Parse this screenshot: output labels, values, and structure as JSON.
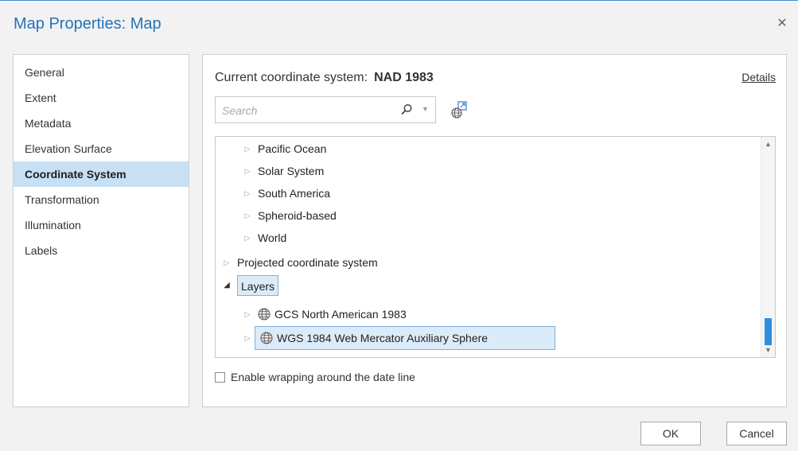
{
  "dialog": {
    "title": "Map Properties: Map",
    "close_glyph": "✕"
  },
  "sidebar": {
    "items": [
      {
        "label": "General"
      },
      {
        "label": "Extent"
      },
      {
        "label": "Metadata"
      },
      {
        "label": "Elevation Surface"
      },
      {
        "label": "Coordinate System",
        "active": true
      },
      {
        "label": "Transformation"
      },
      {
        "label": "Illumination"
      },
      {
        "label": "Labels"
      }
    ]
  },
  "coordinate": {
    "current_label": "Current coordinate system:",
    "current_value": "NAD 1983",
    "details_link": "Details",
    "search_placeholder": "Search",
    "search_icon": "search-icon",
    "globe_icon": "add-coordinate-system-icon"
  },
  "tree": {
    "items": [
      {
        "label": "Pacific Ocean",
        "level": 1,
        "state": "collapsed"
      },
      {
        "label": "Solar System",
        "level": 1,
        "state": "collapsed"
      },
      {
        "label": "South America",
        "level": 1,
        "state": "collapsed"
      },
      {
        "label": "Spheroid-based",
        "level": 1,
        "state": "collapsed"
      },
      {
        "label": "World",
        "level": 1,
        "state": "collapsed"
      },
      {
        "label": "Projected coordinate system",
        "level": 0,
        "state": "collapsed"
      },
      {
        "label": "Layers",
        "level": 0,
        "state": "expanded",
        "highlighted": true
      },
      {
        "label": "GCS North American 1983",
        "level": 1,
        "state": "collapsed",
        "icon": "globe-icon"
      },
      {
        "label": "WGS 1984 Web Mercator Auxiliary Sphere",
        "level": 1,
        "state": "collapsed",
        "icon": "globe-icon",
        "selected": true
      }
    ],
    "scroll_fraction": 0.86
  },
  "options": {
    "wrap_label": "Enable wrapping around the date line",
    "wrap_checked": false
  },
  "buttons": {
    "ok": "OK",
    "cancel": "Cancel"
  },
  "colors": {
    "accent": "#2573b8",
    "selection": "#c7e0f4",
    "scroll_thumb": "#2f8ee0"
  }
}
